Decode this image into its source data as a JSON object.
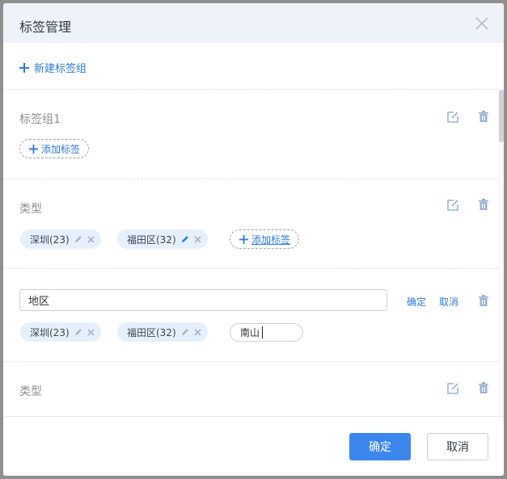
{
  "dialog": {
    "title": "标签管理",
    "new_group_label": "新建标签组"
  },
  "groups": [
    {
      "title": "标签组1",
      "tags": [],
      "add_tag_label": "添加标签"
    },
    {
      "title": "类型",
      "tags": [
        {
          "label": "深圳(23)"
        },
        {
          "label": "福田区(32)"
        }
      ],
      "add_tag_label": "添加标签"
    },
    {
      "editing": true,
      "name_value": "地区",
      "confirm_label": "确定",
      "cancel_label": "取消",
      "tags": [
        {
          "label": "深圳(23)"
        },
        {
          "label": "福田区(32)"
        }
      ],
      "new_tag_value": "南山"
    },
    {
      "title": "类型"
    }
  ],
  "footer": {
    "confirm_label": "确定",
    "cancel_label": "取消"
  },
  "colors": {
    "accent": "#2f78d8",
    "primary_button": "#3d86ee",
    "tag_background": "#e5f0fc",
    "header_background": "#eef3fa",
    "icon": "#9ab2cf"
  },
  "icons": {
    "close": "close-icon",
    "plus": "plus-icon",
    "edit": "edit-icon",
    "delete": "trash-icon",
    "tag_edit": "pencil-icon",
    "tag_remove": "x-icon"
  }
}
